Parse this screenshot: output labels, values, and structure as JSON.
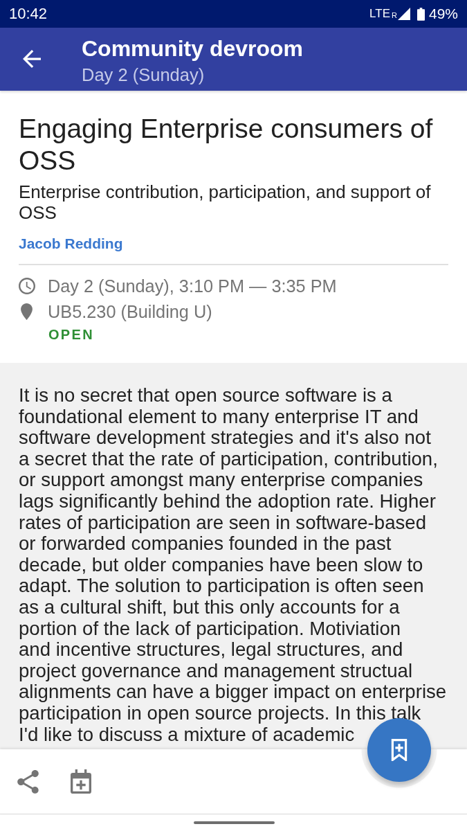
{
  "status_bar": {
    "time": "10:42",
    "network": "LTE",
    "roaming": "R",
    "battery": "49%"
  },
  "app_bar": {
    "title": "Community devroom",
    "subtitle": "Day 2 (Sunday)"
  },
  "talk": {
    "title": "Engaging Enterprise consumers of OSS",
    "subtitle": "Enterprise contribution, participation, and support of OSS",
    "speakers": [
      "Jacob Redding"
    ],
    "time": "Day 2 (Sunday), 3:10 PM — 3:35 PM",
    "room": "UB5.230 (Building U)",
    "room_status": "OPEN"
  },
  "description_lines": [
    "It is no secret that open source software is a",
    "foundational element to many enterprise IT and",
    "software development strategies and it's also not",
    "a secret that the rate of participation, contribution,",
    "or support amongst many enterprise companies",
    "lags significantly behind the adoption rate. Higher",
    "rates of participation are seen in software-based",
    "or forwarded companies founded in the past",
    "decade, but older companies have been slow to",
    "adapt. The solution to participation is often seen",
    "as a cultural shift, but this only accounts for a",
    "portion of the lack of participation. Motiviation",
    "and incentive structures, legal structures, and",
    "project governance and management structual",
    "alignments can have a bigger impact on enterprise",
    "participation in open source projects. In this talk",
    "I'd like to discuss a mixture of academic"
  ]
}
